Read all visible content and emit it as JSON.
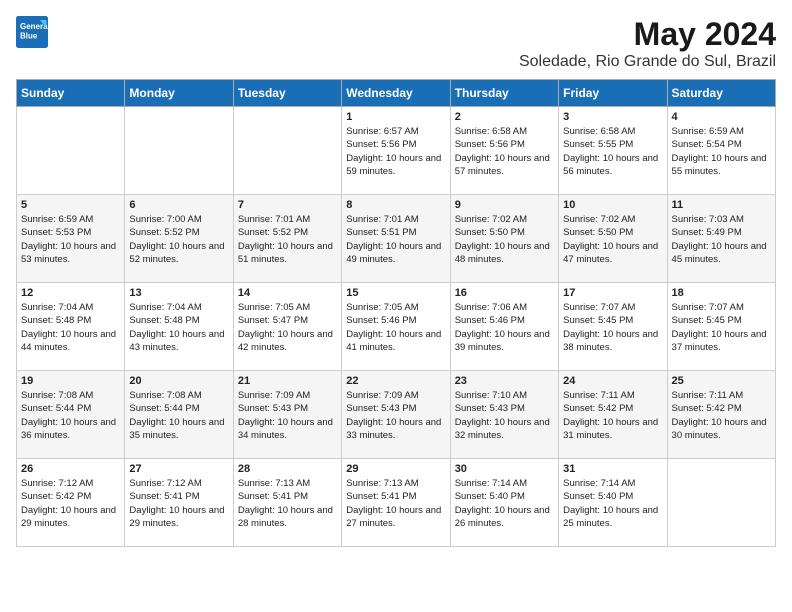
{
  "header": {
    "logo_line1": "General",
    "logo_line2": "Blue",
    "month": "May 2024",
    "location": "Soledade, Rio Grande do Sul, Brazil"
  },
  "weekdays": [
    "Sunday",
    "Monday",
    "Tuesday",
    "Wednesday",
    "Thursday",
    "Friday",
    "Saturday"
  ],
  "weeks": [
    [
      {
        "day": "",
        "sunrise": "",
        "sunset": "",
        "daylight": ""
      },
      {
        "day": "",
        "sunrise": "",
        "sunset": "",
        "daylight": ""
      },
      {
        "day": "",
        "sunrise": "",
        "sunset": "",
        "daylight": ""
      },
      {
        "day": "1",
        "sunrise": "Sunrise: 6:57 AM",
        "sunset": "Sunset: 5:56 PM",
        "daylight": "Daylight: 10 hours and 59 minutes."
      },
      {
        "day": "2",
        "sunrise": "Sunrise: 6:58 AM",
        "sunset": "Sunset: 5:56 PM",
        "daylight": "Daylight: 10 hours and 57 minutes."
      },
      {
        "day": "3",
        "sunrise": "Sunrise: 6:58 AM",
        "sunset": "Sunset: 5:55 PM",
        "daylight": "Daylight: 10 hours and 56 minutes."
      },
      {
        "day": "4",
        "sunrise": "Sunrise: 6:59 AM",
        "sunset": "Sunset: 5:54 PM",
        "daylight": "Daylight: 10 hours and 55 minutes."
      }
    ],
    [
      {
        "day": "5",
        "sunrise": "Sunrise: 6:59 AM",
        "sunset": "Sunset: 5:53 PM",
        "daylight": "Daylight: 10 hours and 53 minutes."
      },
      {
        "day": "6",
        "sunrise": "Sunrise: 7:00 AM",
        "sunset": "Sunset: 5:52 PM",
        "daylight": "Daylight: 10 hours and 52 minutes."
      },
      {
        "day": "7",
        "sunrise": "Sunrise: 7:01 AM",
        "sunset": "Sunset: 5:52 PM",
        "daylight": "Daylight: 10 hours and 51 minutes."
      },
      {
        "day": "8",
        "sunrise": "Sunrise: 7:01 AM",
        "sunset": "Sunset: 5:51 PM",
        "daylight": "Daylight: 10 hours and 49 minutes."
      },
      {
        "day": "9",
        "sunrise": "Sunrise: 7:02 AM",
        "sunset": "Sunset: 5:50 PM",
        "daylight": "Daylight: 10 hours and 48 minutes."
      },
      {
        "day": "10",
        "sunrise": "Sunrise: 7:02 AM",
        "sunset": "Sunset: 5:50 PM",
        "daylight": "Daylight: 10 hours and 47 minutes."
      },
      {
        "day": "11",
        "sunrise": "Sunrise: 7:03 AM",
        "sunset": "Sunset: 5:49 PM",
        "daylight": "Daylight: 10 hours and 45 minutes."
      }
    ],
    [
      {
        "day": "12",
        "sunrise": "Sunrise: 7:04 AM",
        "sunset": "Sunset: 5:48 PM",
        "daylight": "Daylight: 10 hours and 44 minutes."
      },
      {
        "day": "13",
        "sunrise": "Sunrise: 7:04 AM",
        "sunset": "Sunset: 5:48 PM",
        "daylight": "Daylight: 10 hours and 43 minutes."
      },
      {
        "day": "14",
        "sunrise": "Sunrise: 7:05 AM",
        "sunset": "Sunset: 5:47 PM",
        "daylight": "Daylight: 10 hours and 42 minutes."
      },
      {
        "day": "15",
        "sunrise": "Sunrise: 7:05 AM",
        "sunset": "Sunset: 5:46 PM",
        "daylight": "Daylight: 10 hours and 41 minutes."
      },
      {
        "day": "16",
        "sunrise": "Sunrise: 7:06 AM",
        "sunset": "Sunset: 5:46 PM",
        "daylight": "Daylight: 10 hours and 39 minutes."
      },
      {
        "day": "17",
        "sunrise": "Sunrise: 7:07 AM",
        "sunset": "Sunset: 5:45 PM",
        "daylight": "Daylight: 10 hours and 38 minutes."
      },
      {
        "day": "18",
        "sunrise": "Sunrise: 7:07 AM",
        "sunset": "Sunset: 5:45 PM",
        "daylight": "Daylight: 10 hours and 37 minutes."
      }
    ],
    [
      {
        "day": "19",
        "sunrise": "Sunrise: 7:08 AM",
        "sunset": "Sunset: 5:44 PM",
        "daylight": "Daylight: 10 hours and 36 minutes."
      },
      {
        "day": "20",
        "sunrise": "Sunrise: 7:08 AM",
        "sunset": "Sunset: 5:44 PM",
        "daylight": "Daylight: 10 hours and 35 minutes."
      },
      {
        "day": "21",
        "sunrise": "Sunrise: 7:09 AM",
        "sunset": "Sunset: 5:43 PM",
        "daylight": "Daylight: 10 hours and 34 minutes."
      },
      {
        "day": "22",
        "sunrise": "Sunrise: 7:09 AM",
        "sunset": "Sunset: 5:43 PM",
        "daylight": "Daylight: 10 hours and 33 minutes."
      },
      {
        "day": "23",
        "sunrise": "Sunrise: 7:10 AM",
        "sunset": "Sunset: 5:43 PM",
        "daylight": "Daylight: 10 hours and 32 minutes."
      },
      {
        "day": "24",
        "sunrise": "Sunrise: 7:11 AM",
        "sunset": "Sunset: 5:42 PM",
        "daylight": "Daylight: 10 hours and 31 minutes."
      },
      {
        "day": "25",
        "sunrise": "Sunrise: 7:11 AM",
        "sunset": "Sunset: 5:42 PM",
        "daylight": "Daylight: 10 hours and 30 minutes."
      }
    ],
    [
      {
        "day": "26",
        "sunrise": "Sunrise: 7:12 AM",
        "sunset": "Sunset: 5:42 PM",
        "daylight": "Daylight: 10 hours and 29 minutes."
      },
      {
        "day": "27",
        "sunrise": "Sunrise: 7:12 AM",
        "sunset": "Sunset: 5:41 PM",
        "daylight": "Daylight: 10 hours and 29 minutes."
      },
      {
        "day": "28",
        "sunrise": "Sunrise: 7:13 AM",
        "sunset": "Sunset: 5:41 PM",
        "daylight": "Daylight: 10 hours and 28 minutes."
      },
      {
        "day": "29",
        "sunrise": "Sunrise: 7:13 AM",
        "sunset": "Sunset: 5:41 PM",
        "daylight": "Daylight: 10 hours and 27 minutes."
      },
      {
        "day": "30",
        "sunrise": "Sunrise: 7:14 AM",
        "sunset": "Sunset: 5:40 PM",
        "daylight": "Daylight: 10 hours and 26 minutes."
      },
      {
        "day": "31",
        "sunrise": "Sunrise: 7:14 AM",
        "sunset": "Sunset: 5:40 PM",
        "daylight": "Daylight: 10 hours and 25 minutes."
      },
      {
        "day": "",
        "sunrise": "",
        "sunset": "",
        "daylight": ""
      }
    ]
  ]
}
